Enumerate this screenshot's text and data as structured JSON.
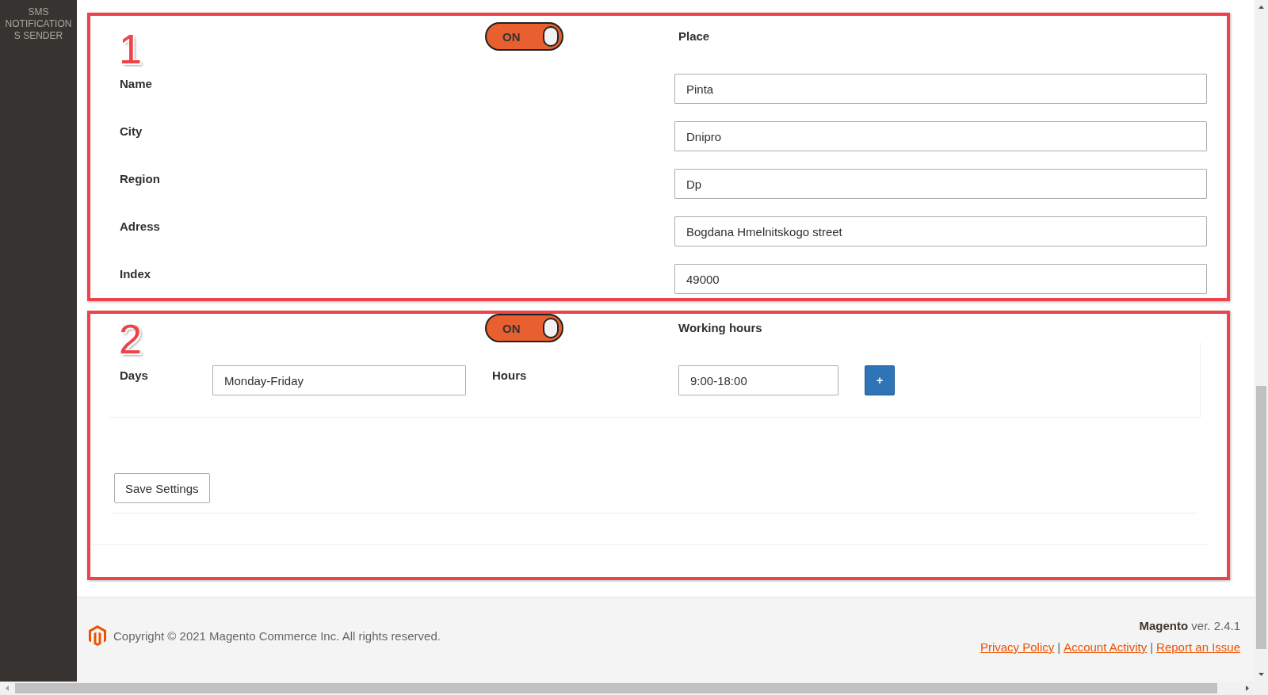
{
  "sidebar": {
    "item_lines": [
      "SMS",
      "NOTIFICATION",
      "S SENDER"
    ]
  },
  "sections": [
    {
      "annotation": "1",
      "toggle": {
        "label": "ON",
        "on": true
      },
      "title": "Place",
      "fields": [
        {
          "label": "Name",
          "value": "Pinta"
        },
        {
          "label": "City",
          "value": "Dnipro"
        },
        {
          "label": "Region",
          "value": "Dp"
        },
        {
          "label": "Adress",
          "value": "Bogdana Hmelnitskogo street"
        },
        {
          "label": "Index",
          "value": "49000"
        }
      ]
    },
    {
      "annotation": "2",
      "toggle": {
        "label": "ON",
        "on": true
      },
      "title": "Working hours",
      "schedule": [
        {
          "days_label": "Days",
          "days_value": "Monday-Friday",
          "hours_label": "Hours",
          "hours_value": "9:00-18:00",
          "add_button": "+"
        }
      ],
      "save_button": "Save Settings"
    }
  ],
  "footer": {
    "copyright": "Copyright © 2021 Magento Commerce Inc. All rights reserved.",
    "version": "**Magento** ver. 2.4.1",
    "links": [
      {
        "kind": "link",
        "text": "Privacy Policy"
      },
      {
        "kind": "separator",
        "text": "|"
      },
      {
        "kind": "link",
        "text": "Account Activity"
      },
      {
        "kind": "separator",
        "text": "|"
      },
      {
        "kind": "link",
        "text": "Report an Issue"
      }
    ]
  }
}
